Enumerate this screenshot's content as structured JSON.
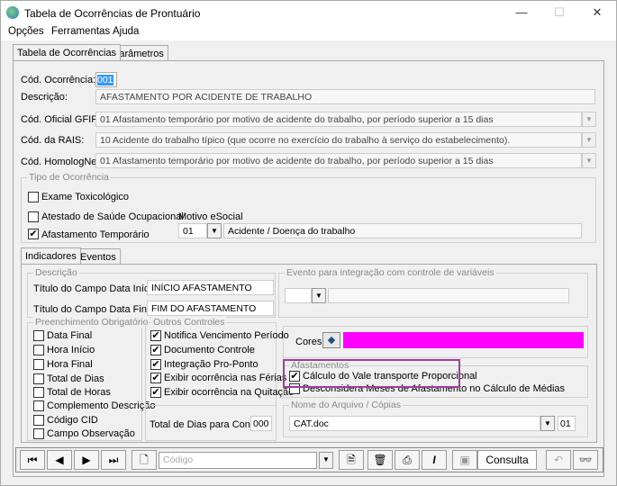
{
  "window": {
    "title": "Tabela de Ocorrências de Prontuário",
    "minimize": "—",
    "maximize": "☐",
    "close": "✕"
  },
  "menu": [
    "Opções",
    "Ferramentas",
    "Ajuda"
  ],
  "tabs": [
    "Tabela de Ocorrências",
    "Parâmetros"
  ],
  "form": {
    "cod_ocorrencia_label": "Cód. Ocorrência:",
    "cod_ocorrencia_value": "001",
    "descricao_label": "Descrição:",
    "descricao_value": "AFASTAMENTO POR ACIDENTE DE TRABALHO",
    "gfip_label": "Cód. Oficial GFIP:",
    "gfip_value": "01 Afastamento temporário por motivo de acidente do trabalho, por período superior a 15 dias",
    "rais_label": "Cód. da RAIS:",
    "rais_value": "10 Acidente do trabalho típico (que ocorre no exercício do trabalho à serviço do estabelecimento).",
    "homolog_label": "Cód. HomologNet:",
    "homolog_value": "01  Afastamento temporário por motivo de acidente do trabalho, por período superior a 15 dias"
  },
  "tipo": {
    "title": "Tipo de Ocorrência",
    "exame": "Exame Toxicológico",
    "atestado": "Atestado de Saúde Ocupacional",
    "afastamento": "Afastamento Temporário",
    "motivo_label": "Motivo eSocial",
    "motivo_code": "01",
    "motivo_desc": "Acidente / Doença do trabalho"
  },
  "subtabs": [
    "Indicadores",
    "Eventos"
  ],
  "descricao_group": {
    "title": "Descrição",
    "inicio_label": "Título do Campo Data Início:",
    "inicio_value": "INÍCIO AFASTAMENTO",
    "final_label": "Título do Campo Data Final:",
    "final_value": "FIM DO AFASTAMENTO"
  },
  "evento_group": {
    "title": "Evento para integração com controle de variáveis"
  },
  "preench": {
    "title": "Preenchimento Obrigatório",
    "items": [
      "Data Final",
      "Hora Início",
      "Hora Final",
      "Total de Dias",
      "Total de Horas",
      "Complemento Descrição",
      "Código CID",
      "Campo Observação"
    ]
  },
  "outros": {
    "title": "Outros Controles",
    "items": [
      "Notifica Vencimento Período",
      "Documento Controle",
      "Integração Pro-Ponto",
      "Exibir ocorrência nas Férias",
      "Exibir ocorrência na Quitação"
    ],
    "total_label": "Total de Dias para Controle:",
    "total_value": "000"
  },
  "cores": {
    "label": "Cores",
    "color": "#ff00ff"
  },
  "afast": {
    "title": "Afastamentos",
    "vale": "Cálculo do Vale transporte Proporcional",
    "desconsidera": "Desconsidera Meses de Afastamento no Cálculo de Médias"
  },
  "arquivo": {
    "title": "Nome do Arquivo / Cópias",
    "file": "CAT.doc",
    "copies": "01"
  },
  "toolbar": {
    "codigo_placeholder": "Código",
    "consulta": "Consulta"
  }
}
